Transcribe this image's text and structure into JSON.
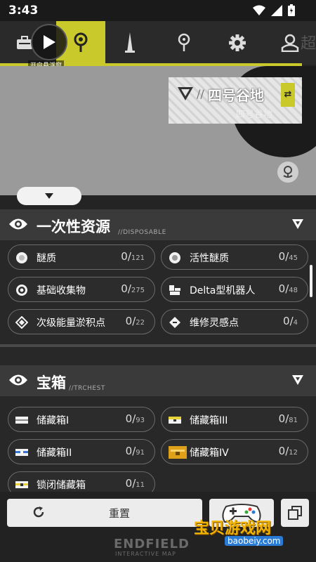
{
  "status_bar": {
    "time": "3:43",
    "icons": [
      "wifi-icon",
      "signal-icon",
      "battery-icon"
    ]
  },
  "toolbar": {
    "float_label": "开启悬浮窗",
    "items": [
      "briefcase-icon",
      "map-pin-icon",
      "tower-icon",
      "location-icon",
      "gear-icon",
      "user-icon"
    ],
    "edge_text": "超"
  },
  "map": {
    "location_title": "四号谷地",
    "location_sub": "四号谷地",
    "swap_symbol": "⇄"
  },
  "sections": [
    {
      "title": "一次性资源",
      "sub": "//DISPOSABLE",
      "items": [
        {
          "label": "醚质",
          "count": "0",
          "total": "121",
          "icon": "orb-icon"
        },
        {
          "label": "活性醚质",
          "count": "0",
          "total": "45",
          "icon": "orb-icon"
        },
        {
          "label": "基础收集物",
          "count": "0",
          "total": "275",
          "icon": "target-icon"
        },
        {
          "label": "Delta型机器人",
          "count": "0",
          "total": "48",
          "icon": "robot-icon"
        },
        {
          "label": "次级能量淤积点",
          "count": "0",
          "total": "22",
          "icon": "energy-icon"
        },
        {
          "label": "维修灵感点",
          "count": "0",
          "total": "4",
          "icon": "wrench-icon"
        }
      ]
    },
    {
      "title": "宝箱",
      "sub": "//TRCHEST",
      "items": [
        {
          "label": "储藏箱I",
          "count": "0",
          "total": "93",
          "icon": "chest-white-icon"
        },
        {
          "label": "储藏箱III",
          "count": "0",
          "total": "81",
          "icon": "chest-yellow-icon"
        },
        {
          "label": "储藏箱II",
          "count": "0",
          "total": "91",
          "icon": "chest-blue-icon"
        },
        {
          "label": "储藏箱IV",
          "count": "0",
          "total": "12",
          "icon": "chest-gold-icon"
        },
        {
          "label": "锁闭储藏箱",
          "count": "0",
          "total": "11",
          "icon": "chest-locked-icon"
        }
      ]
    }
  ],
  "bottom": {
    "reset_label": "重置",
    "brand": "ENDFIELD",
    "brand_sub": "INTERACTIVE MAP",
    "watermark": "宝贝游戏网",
    "watermark_url": "baobeiy.com"
  },
  "colors": {
    "accent": "#c9c92b",
    "panel": "#282828",
    "header": "#3a3a3a"
  }
}
